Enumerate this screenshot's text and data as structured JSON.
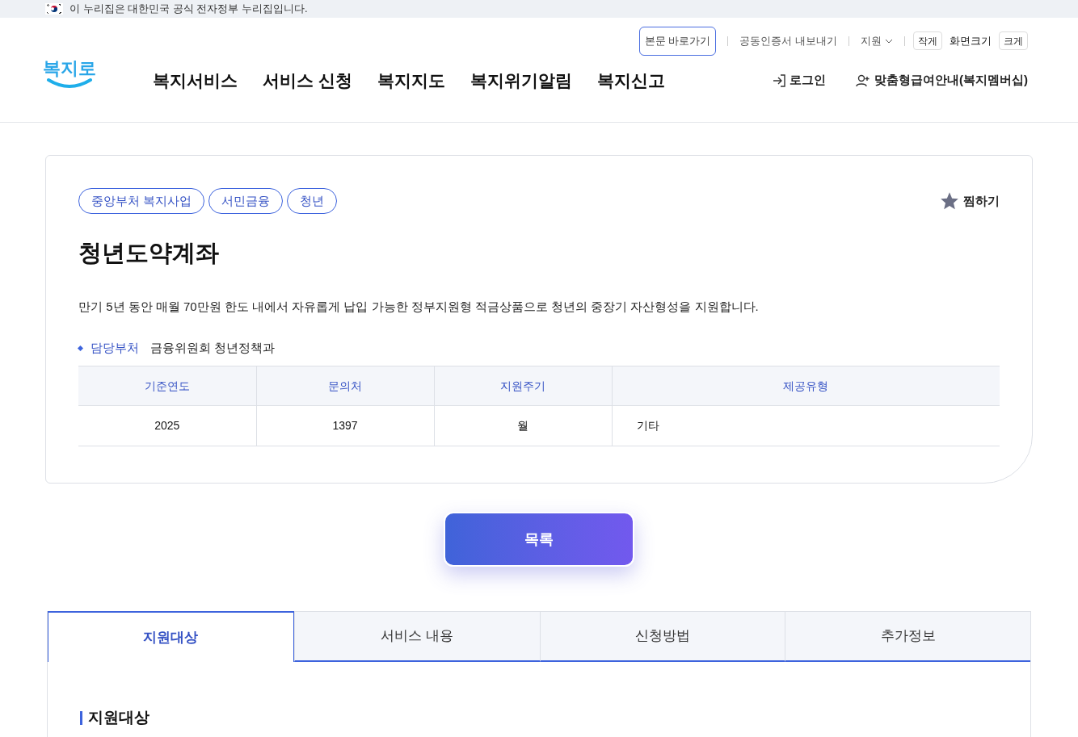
{
  "gov_banner": {
    "text": "이 누리집은 대한민국 공식 전자정부 누리집입니다."
  },
  "utility_links": [
    {
      "kind": "outlined",
      "label": "본문 바로가기"
    },
    {
      "kind": "plain",
      "label": "공동인증서 내보내기"
    },
    {
      "kind": "dropdown",
      "label": "지원"
    }
  ],
  "font_size": {
    "smaller": "작게",
    "label": "화면크기",
    "larger": "크게"
  },
  "logo": {
    "text": "복지로"
  },
  "nav": [
    "복지서비스",
    "서비스 신청",
    "복지지도",
    "복지위기알림",
    "복지신고"
  ],
  "account_links": [
    {
      "kind": "login",
      "label": "로그인"
    },
    {
      "kind": "membership",
      "label": "맞춤형급여안내(복지멤버십)"
    }
  ],
  "service": {
    "tags": [
      "중앙부처 복지사업",
      "서민금융",
      "청년"
    ],
    "favorite": {
      "label": "찜하기",
      "selected": false
    },
    "title": "청년도약계좌",
    "description": "만기 5년 동안 매월 70만원 한도 내에서 자유롭게 납입 가능한 정부지원형 적금상품으로 청년의 중장기 자산형성을 지원합니다.",
    "department": {
      "label": "담당부처",
      "value": "금융위원회 청년정책과"
    },
    "table": {
      "columns": [
        "기준연도",
        "문의처",
        "지원주기",
        "제공유형"
      ],
      "rows": [
        [
          "2025",
          "1397",
          "월",
          "기타"
        ]
      ]
    }
  },
  "list_button": "목록",
  "tabs": [
    {
      "label": "지원대상",
      "selected": true
    },
    {
      "label": "서비스 내용",
      "selected": false
    },
    {
      "label": "신청방법",
      "selected": false
    },
    {
      "label": "추가정보",
      "selected": false
    }
  ],
  "section_heading": "지원대상"
}
